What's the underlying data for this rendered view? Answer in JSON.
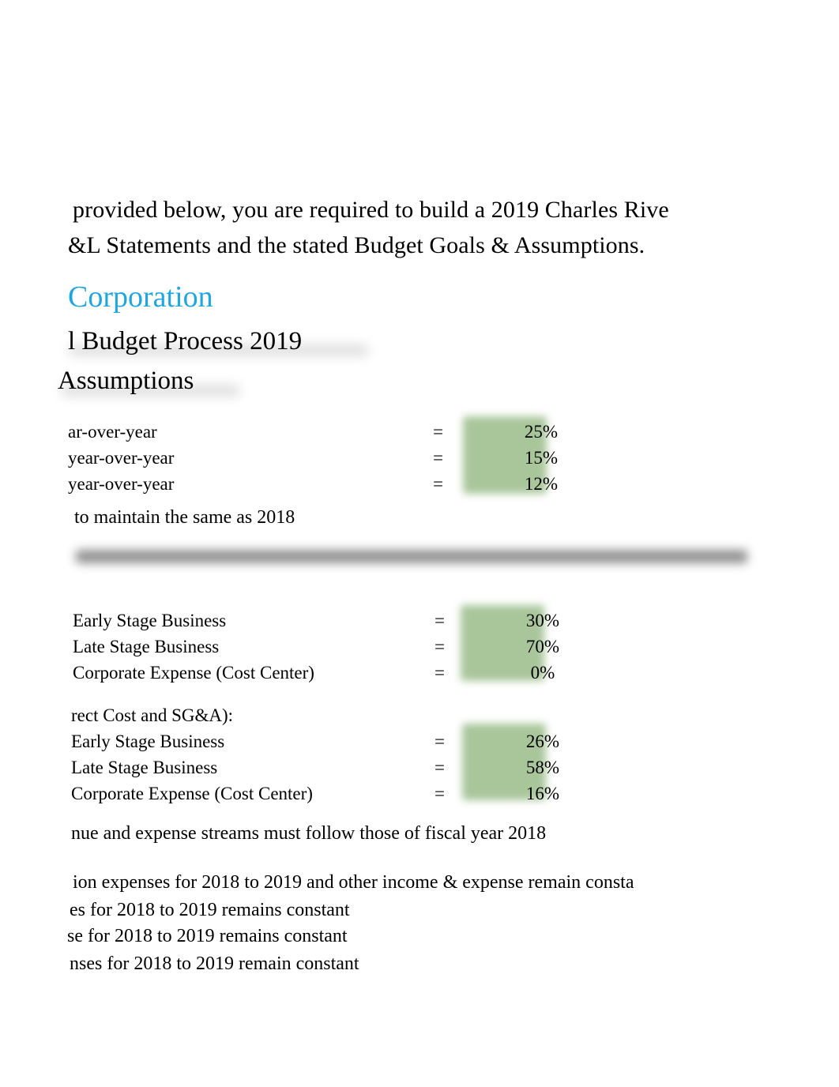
{
  "document": {
    "intro": {
      "line1": "provided below, you are required to build a 2019 Charles Rive",
      "line2": "&L Statements and the stated Budget Goals & Assumptions."
    },
    "headings": {
      "corporation": "Corporation",
      "budget_process": "l Budget Process 2019",
      "assumptions": "Assumptions"
    },
    "growth_group": {
      "rows": [
        {
          "label": "ar-over-year",
          "eq": "=",
          "value": "25%"
        },
        {
          "label": "year-over-year",
          "eq": "=",
          "value": "15%"
        },
        {
          "label": "year-over-year",
          "eq": "=",
          "value": "12%"
        }
      ],
      "note": "to maintain the same as 2018"
    },
    "revenue_mix_group": {
      "rows": [
        {
          "label": "Early Stage Business",
          "eq": "=",
          "value": "30%"
        },
        {
          "label": "Late Stage Business",
          "eq": "=",
          "value": "70%"
        },
        {
          "label": "Corporate Expense (Cost Center)",
          "eq": "=",
          "value": "0%"
        }
      ]
    },
    "cost_group": {
      "group_label": "rect Cost and SG&A):",
      "rows": [
        {
          "label": "Early Stage Business",
          "eq": "=",
          "value": "26%"
        },
        {
          "label": "Late Stage Business",
          "eq": "=",
          "value": "58%"
        },
        {
          "label": "Corporate Expense (Cost Center)",
          "eq": "=",
          "value": "16%"
        }
      ]
    },
    "notes": {
      "a": "nue and expense streams must follow those of fiscal year 2018",
      "b": "ion expenses for 2018 to 2019 and other income & expense remain consta",
      "c": "es for 2018 to 2019 remains constant",
      "d": "se for 2018 to 2019 remains constant",
      "e": "nses for 2018 to 2019 remain constant"
    },
    "colors": {
      "heading_blue": "#1fa5e0",
      "highlight_green": "#a9c69b",
      "redaction_gray": "#8b8b8b",
      "text": "#000000",
      "background": "#ffffff"
    }
  }
}
